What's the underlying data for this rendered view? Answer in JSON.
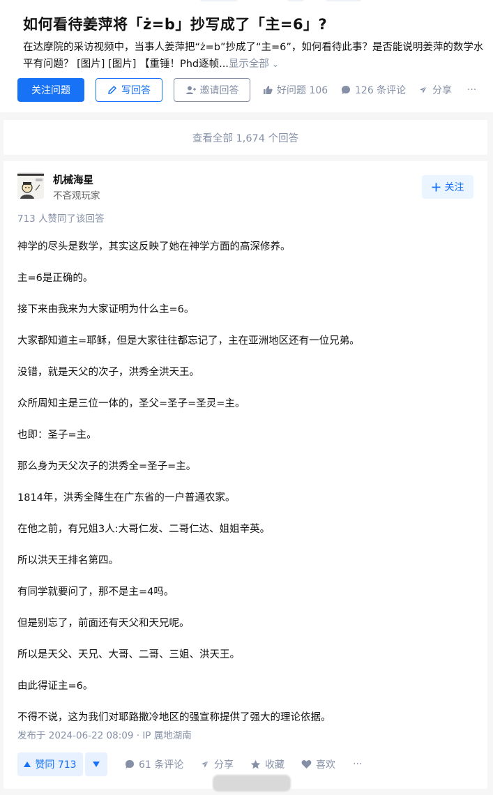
{
  "question": {
    "title": "如何看待姜萍将「ż=b」抄写成了「主=6」?",
    "detail": "在达摩院的采访视频中，当事人姜萍把“ż=b”抄成了“主=6”，如何看待此事？是否能说明姜萍的数学水平有问题？ [图片] [图片] 【重锤！Phd逐帧...",
    "show_all": "显示全部",
    "follow_label": "关注问题",
    "write_label": "写回答",
    "invite_label": "邀请回答",
    "good_question": "好问题 106",
    "comments": "126 条评论",
    "share": "分享",
    "more": "···"
  },
  "view_all": "查看全部 1,674 个回答",
  "answer": {
    "author_name": "机械海星",
    "author_bio": "不吝观玩家",
    "follow_label": "关注",
    "upvote_info": "713 人赞同了该回答",
    "paragraphs": [
      "神学的尽头是数学，其实这反映了她在神学方面的高深修养。",
      "主=6是正确的。",
      "接下来由我来为大家证明为什么主=6。",
      "大家都知道主=耶稣，但是大家往往都忘记了，主在亚洲地区还有一位兄弟。",
      "没错，就是天父的次子，洪秀全洪天王。",
      "众所周知主是三位一体的，圣父=圣子=圣灵=主。",
      "也即：圣子=主。",
      "那么身为天父次子的洪秀全=圣子=主。",
      "1814年，洪秀全降生在广东省的一户普通农家。",
      "在他之前，有兄姐3人:大哥仁发、二哥仁达、姐姐辛英。",
      "所以洪天王排名第四。",
      "有同学就要问了，那不是主=4吗。",
      "但是别忘了，前面还有天父和天兄呢。",
      "所以是天父、天兄、大哥、二哥、三姐、洪天王。",
      "由此得证主=6。",
      "不得不说，这为我们对耶路撒冷地区的强宣称提供了强大的理论依据。"
    ],
    "post_time": "发布于 2024-06-22 08:09 · IP 属地湖南",
    "vote_up": "赞同 713",
    "comments": "61 条评论",
    "share": "分享",
    "collect": "收藏",
    "like": "喜欢",
    "more": "···"
  },
  "colors": {
    "accent": "#1772f6",
    "muted": "#8590a6"
  }
}
